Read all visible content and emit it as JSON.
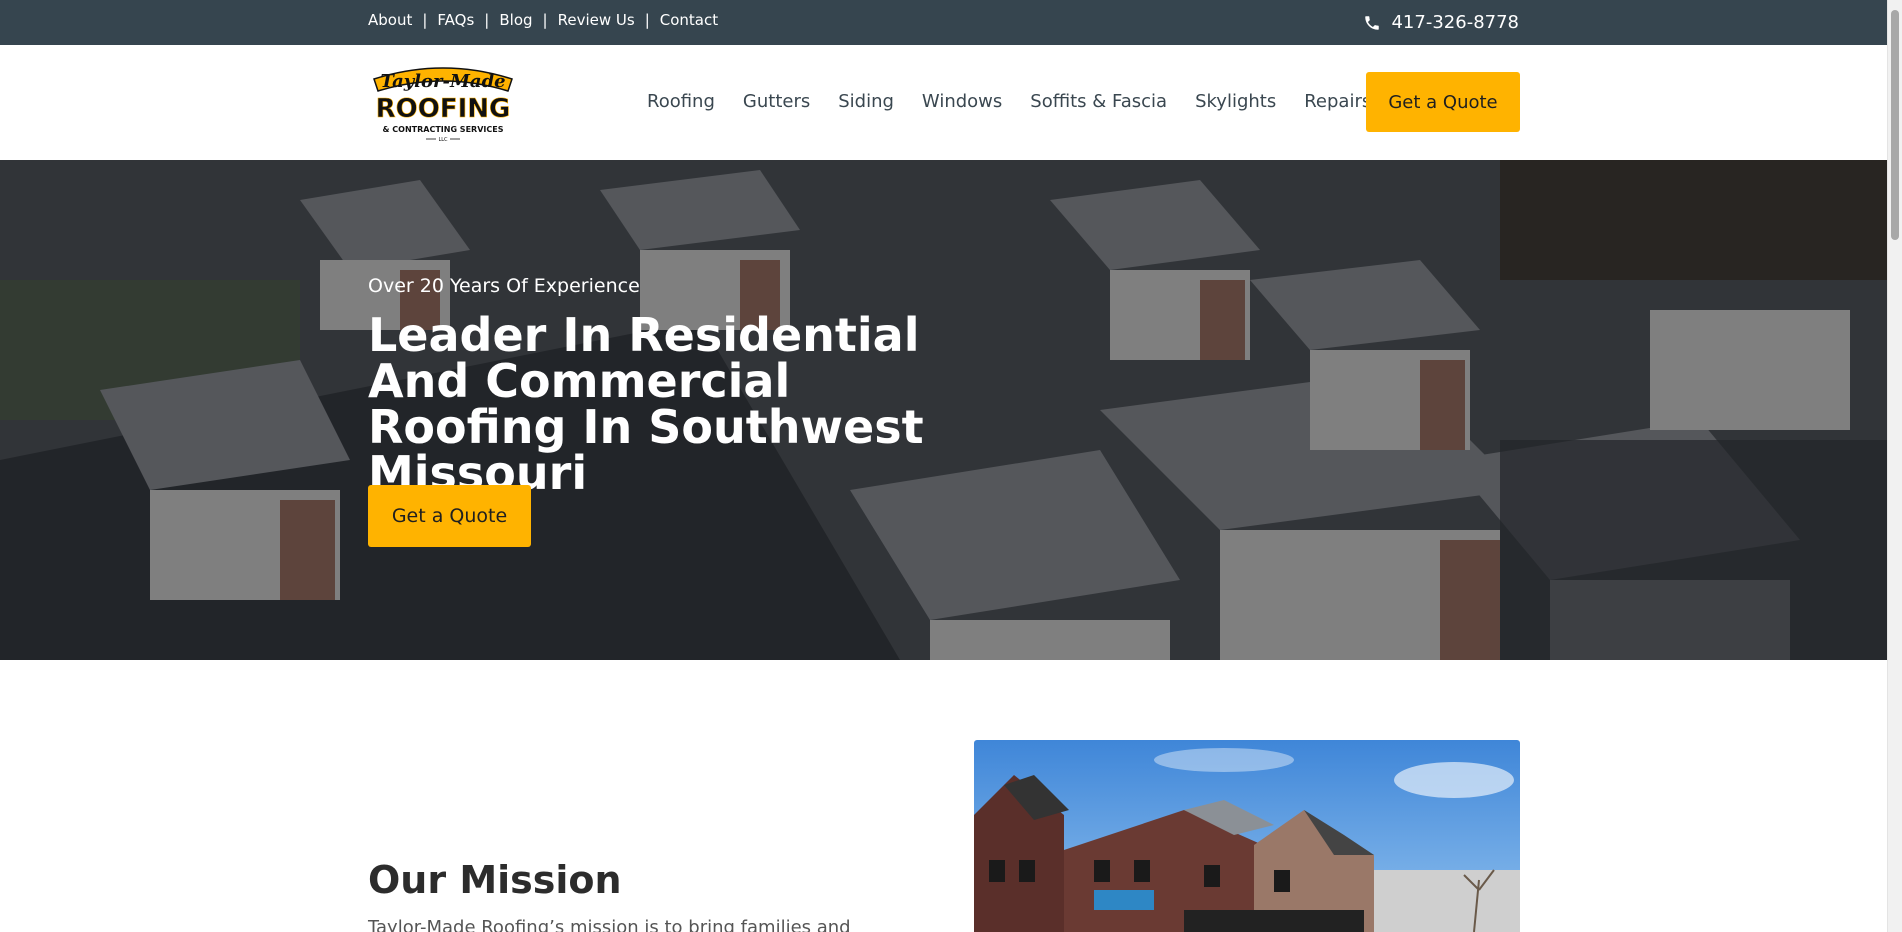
{
  "topbar": {
    "links": [
      "About",
      "FAQs",
      "Blog",
      "Review Us",
      "Contact"
    ],
    "separator": "|",
    "phone": "417-326-8778",
    "phone_icon": "phone-icon",
    "background": "#36454f"
  },
  "header": {
    "logo": {
      "line1": "Taylor-Made",
      "line2": "ROOFING",
      "line3": "& CONTRACTING SERVICES",
      "line4": "LLC"
    },
    "nav": [
      "Roofing",
      "Gutters",
      "Siding",
      "Windows",
      "Soffits & Fascia",
      "Skylights",
      "Repairs"
    ],
    "cta_label": "Get a Quote",
    "accent": "#ffb300"
  },
  "hero": {
    "kicker": "Over 20 Years Of Experience",
    "title": "Leader In Residential And Commercial Roofing In Southwest Missouri",
    "cta_label": "Get a Quote"
  },
  "mission": {
    "title": "Our Mission",
    "text": "Taylor-Made Roofing’s mission is to bring families and"
  }
}
